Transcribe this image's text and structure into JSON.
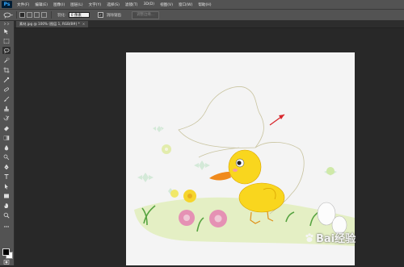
{
  "app": {
    "logo": "Ps"
  },
  "menu": [
    "文件(F)",
    "编辑(E)",
    "图像(I)",
    "图层(L)",
    "文字(Y)",
    "选择(S)",
    "滤镜(T)",
    "3D(D)",
    "视图(V)",
    "窗口(W)",
    "帮助(H)"
  ],
  "options": {
    "feather_label": "羽化:",
    "feather_value": "0 像素",
    "antialias_label": "消除锯齿",
    "antialias_checked": true,
    "refine_edge_label": "调整边缘..."
  },
  "document_tab": {
    "title": "素材.jpg @ 100% (图层 1, RGB/8#) *",
    "close": "×"
  },
  "colors": {
    "foreground": "#000000",
    "background": "#ffffff",
    "accent": "#31a8ff",
    "arrow": "#d8262c"
  },
  "tools": [
    "move-tool",
    "marquee-tool",
    "lasso-tool",
    "quick-select-tool",
    "crop-tool",
    "eyedropper-tool",
    "spot-healing-tool",
    "brush-tool",
    "clone-stamp-tool",
    "history-brush-tool",
    "eraser-tool",
    "gradient-tool",
    "blur-tool",
    "dodge-tool",
    "pen-tool",
    "type-tool",
    "path-select-tool",
    "shape-tool",
    "hand-tool",
    "zoom-tool"
  ],
  "watermark": {
    "text": "Bai经验"
  }
}
